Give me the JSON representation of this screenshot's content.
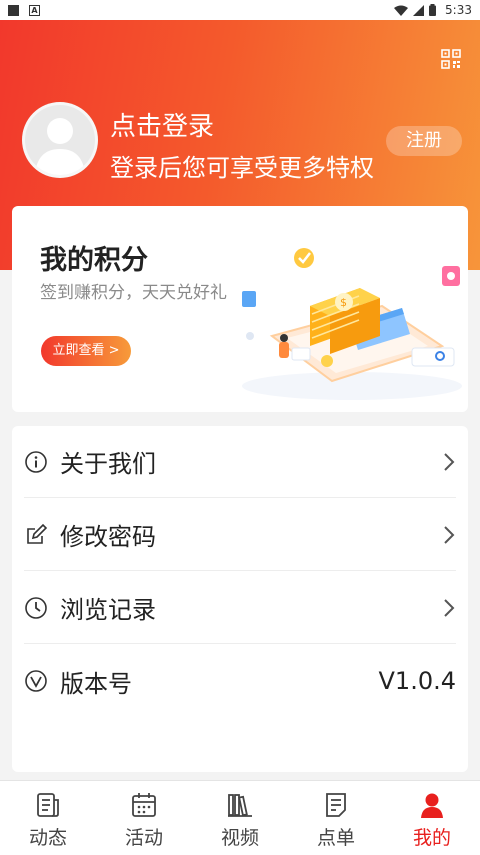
{
  "status_bar": {
    "time": "5:33",
    "left_badge": "A"
  },
  "header": {
    "login_title": "点击登录",
    "login_subtitle": "登录后您可享受更多特权",
    "register_label": "注册",
    "qr_icon": "qr-code-icon"
  },
  "points_card": {
    "title": "我的积分",
    "subtitle": "签到赚积分，天天兑好礼",
    "view_button": "立即查看 >"
  },
  "menu": {
    "items": [
      {
        "label": "关于我们",
        "icon": "info-icon"
      },
      {
        "label": "修改密码",
        "icon": "edit-icon"
      },
      {
        "label": "浏览记录",
        "icon": "clock-icon"
      },
      {
        "label": "版本号",
        "icon": "version-icon",
        "value": "V1.0.4"
      }
    ]
  },
  "tabs": [
    {
      "label": "动态",
      "icon": "news-icon"
    },
    {
      "label": "活动",
      "icon": "calendar-icon"
    },
    {
      "label": "视频",
      "icon": "books-icon"
    },
    {
      "label": "点单",
      "icon": "order-icon"
    },
    {
      "label": "我的",
      "icon": "person-icon",
      "active": true
    }
  ],
  "colors": {
    "brand_red": "#e8201e",
    "header_gradient_start": "#f2382c",
    "header_gradient_end": "#f7953a"
  }
}
